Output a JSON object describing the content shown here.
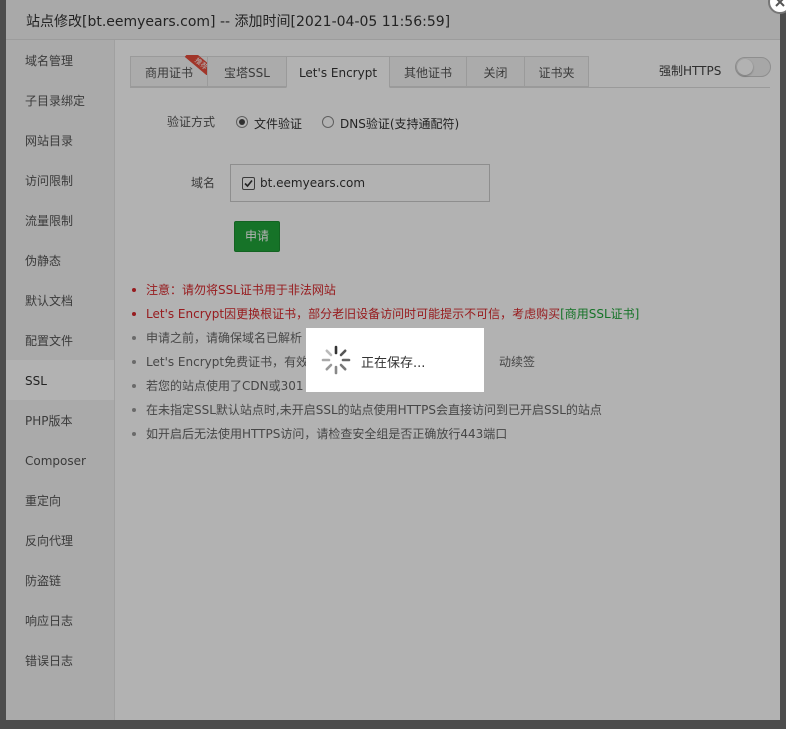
{
  "window": {
    "title": "站点修改[bt.eemyears.com] -- 添加时间[2021-04-05 11:56:59]"
  },
  "sidebar": {
    "items": [
      {
        "label": "域名管理"
      },
      {
        "label": "子目录绑定"
      },
      {
        "label": "网站目录"
      },
      {
        "label": "访问限制"
      },
      {
        "label": "流量限制"
      },
      {
        "label": "伪静态"
      },
      {
        "label": "默认文档"
      },
      {
        "label": "配置文件"
      },
      {
        "label": "SSL"
      },
      {
        "label": "PHP版本"
      },
      {
        "label": "Composer"
      },
      {
        "label": "重定向"
      },
      {
        "label": "反向代理"
      },
      {
        "label": "防盗链"
      },
      {
        "label": "响应日志"
      },
      {
        "label": "错误日志"
      }
    ],
    "active": "SSL"
  },
  "tabs": {
    "items": [
      {
        "label": "商用证书",
        "badge": "推荐"
      },
      {
        "label": "宝塔SSL"
      },
      {
        "label": "Let's Encrypt"
      },
      {
        "label": "其他证书"
      },
      {
        "label": "关闭"
      },
      {
        "label": "证书夹"
      }
    ],
    "active": "Let's Encrypt"
  },
  "force_https": {
    "label": "强制HTTPS",
    "enabled": false
  },
  "verify": {
    "label": "验证方式",
    "options": [
      {
        "label": "文件验证",
        "checked": true
      },
      {
        "label": "DNS验证(支持通配符)",
        "checked": false
      }
    ]
  },
  "domain": {
    "label": "域名",
    "items": [
      {
        "name": "bt.eemyears.com",
        "checked": true
      }
    ]
  },
  "apply_button": "申请",
  "notes": [
    {
      "text": "注意：请勿将SSL证书用于非法网站",
      "style": "red"
    },
    {
      "text": "Let's Encrypt因更换根证书，部分老旧设备访问时可能提示不可信，考虑购买",
      "link": "[商用SSL证书]",
      "style": "red"
    },
    {
      "text": "申请之前，请确保域名已解析",
      "style": "gray"
    },
    {
      "text": "Let's Encrypt免费证书，有效",
      "tail": "动续签",
      "style": "gray"
    },
    {
      "text": "若您的站点使用了CDN或301",
      "style": "gray"
    },
    {
      "text": "在未指定SSL默认站点时,未开启SSL的站点使用HTTPS会直接访问到已开启SSL的站点",
      "style": "gray"
    },
    {
      "text": "如开启后无法使用HTTPS访问，请检查安全组是否正确放行443端口",
      "style": "gray"
    }
  ],
  "loading": {
    "message": "正在保存..."
  },
  "colors": {
    "accent_green": "#20a53a",
    "warning_red": "#d9292d",
    "ribbon_red": "#e74c3c"
  }
}
